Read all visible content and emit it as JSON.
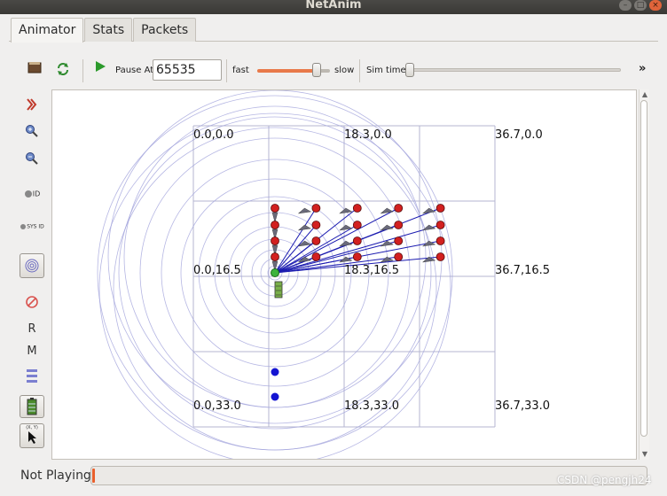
{
  "window": {
    "title": "NetAnim"
  },
  "tabs": [
    {
      "label": "Animator",
      "active": true
    },
    {
      "label": "Stats",
      "active": false
    },
    {
      "label": "Packets",
      "active": false
    }
  ],
  "toolbar": {
    "pause_at_label": "Pause At",
    "pause_at_value": "65535",
    "fast_label": "fast",
    "slow_label": "slow",
    "speed_fraction": 0.82,
    "sim_time_label": "Sim time",
    "sim_time_fraction": 0.0,
    "more_label": "»"
  },
  "left_toolbar": {
    "id_label": "ID",
    "sys_id_label": "SYS ID",
    "r_label": "R",
    "m_label": "M",
    "xy_label": "(X, Y)"
  },
  "canvas": {
    "grid_labels": [
      "0.0,0.0",
      "18.3,0.0",
      "36.7,0.0",
      "0.0,16.5",
      "18.3,16.5",
      "36.7,16.5",
      "0.0,33.0",
      "18.3,33.0",
      "36.7,33.0"
    ],
    "colors": {
      "grid": "#b4b6d0",
      "range_circle": "#a3a4dc",
      "link": "#1b1bb0",
      "node_red": "#d22020",
      "node_blue": "#1414d2",
      "node_green": "#3cb43c",
      "packet_arrow": "#6a6a7a"
    }
  },
  "status": {
    "text": "Not Playing",
    "progress": 0.005
  },
  "watermark": "CSDN @pengjh24"
}
